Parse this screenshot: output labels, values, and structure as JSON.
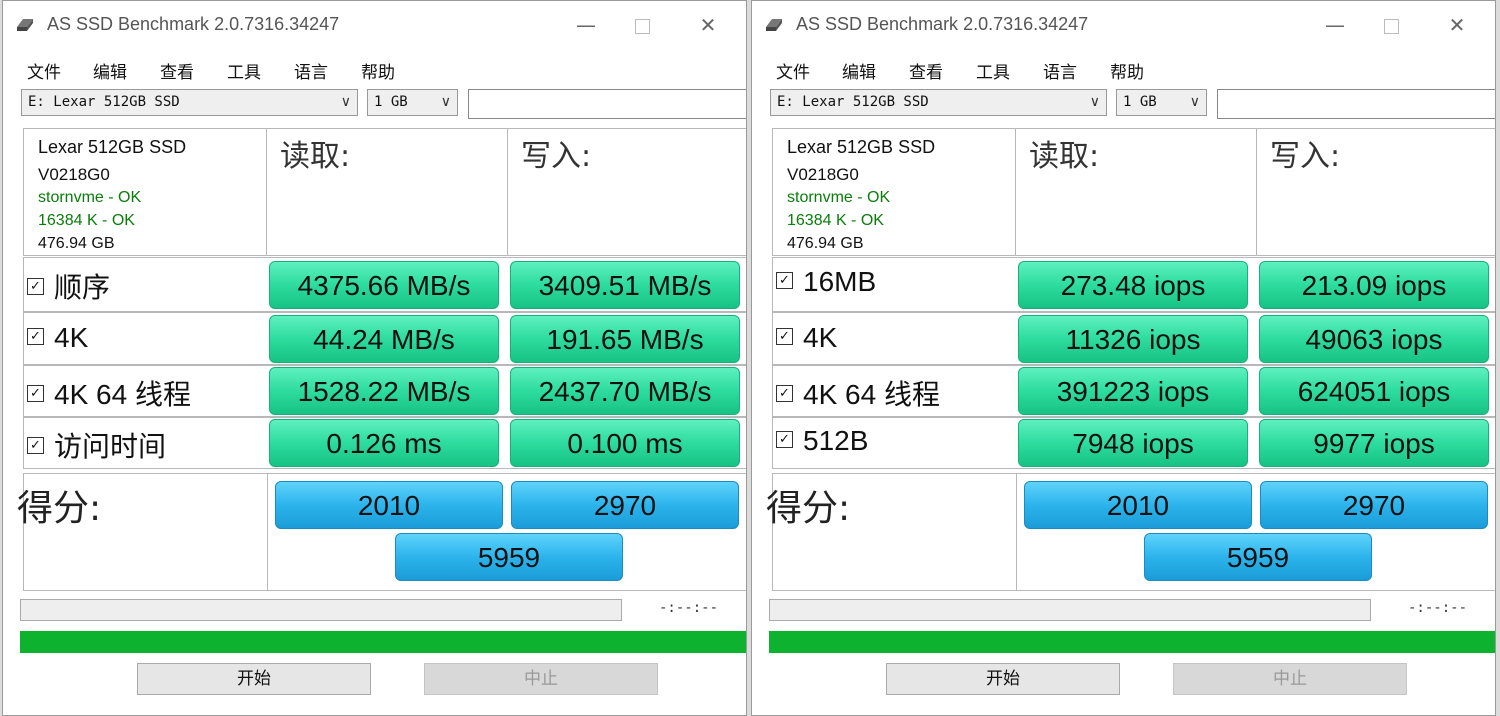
{
  "windows": [
    {
      "title": "AS SSD Benchmark 2.0.7316.34247",
      "menu": [
        "文件",
        "编辑",
        "查看",
        "工具",
        "语言",
        "帮助"
      ],
      "drive_select": "E: Lexar 512GB SSD",
      "size_select": "1 GB",
      "info": {
        "model": "Lexar 512GB SSD",
        "firmware": "V0218G0",
        "driver": "stornvme - OK",
        "alignment": "16384 K - OK",
        "capacity": "476.94 GB"
      },
      "read_header": "读取:",
      "write_header": "写入:",
      "rows": [
        {
          "label": "顺序",
          "read": "4375.66 MB/s",
          "write": "3409.51 MB/s"
        },
        {
          "label": "4K",
          "read": "44.24 MB/s",
          "write": "191.65 MB/s"
        },
        {
          "label": "4K 64 线程",
          "read": "1528.22 MB/s",
          "write": "2437.70 MB/s"
        },
        {
          "label": "访问时间",
          "read": "0.126 ms",
          "write": "0.100 ms"
        }
      ],
      "score_label": "得分:",
      "score_read": "2010",
      "score_write": "2970",
      "score_total": "5959",
      "timer": "-:--:--",
      "start_label": "开始",
      "stop_label": "中止"
    },
    {
      "title": "AS SSD Benchmark 2.0.7316.34247",
      "menu": [
        "文件",
        "编辑",
        "查看",
        "工具",
        "语言",
        "帮助"
      ],
      "drive_select": "E: Lexar 512GB SSD",
      "size_select": "1 GB",
      "info": {
        "model": "Lexar 512GB SSD",
        "firmware": "V0218G0",
        "driver": "stornvme - OK",
        "alignment": "16384 K - OK",
        "capacity": "476.94 GB"
      },
      "read_header": "读取:",
      "write_header": "写入:",
      "rows": [
        {
          "label": "16MB",
          "read": "273.48 iops",
          "write": "213.09 iops"
        },
        {
          "label": "4K",
          "read": "11326 iops",
          "write": "49063 iops"
        },
        {
          "label": "4K 64 线程",
          "read": "391223 iops",
          "write": "624051 iops"
        },
        {
          "label": "512B",
          "read": "7948 iops",
          "write": "9977 iops"
        }
      ],
      "score_label": "得分:",
      "score_read": "2010",
      "score_write": "2970",
      "score_total": "5959",
      "timer": "-:--:--",
      "start_label": "开始",
      "stop_label": "中止"
    }
  ],
  "colors": {
    "ok_green": "#0a7d0a",
    "result_green": "#2ddc9e",
    "score_blue": "#2cb4ec",
    "progress_green": "#0db32e"
  },
  "icons": {
    "app": "ssd-drive-icon",
    "minimize": "minimize-icon",
    "maximize": "maximize-icon",
    "close": "close-icon",
    "dropdown": "chevron-down-icon"
  }
}
